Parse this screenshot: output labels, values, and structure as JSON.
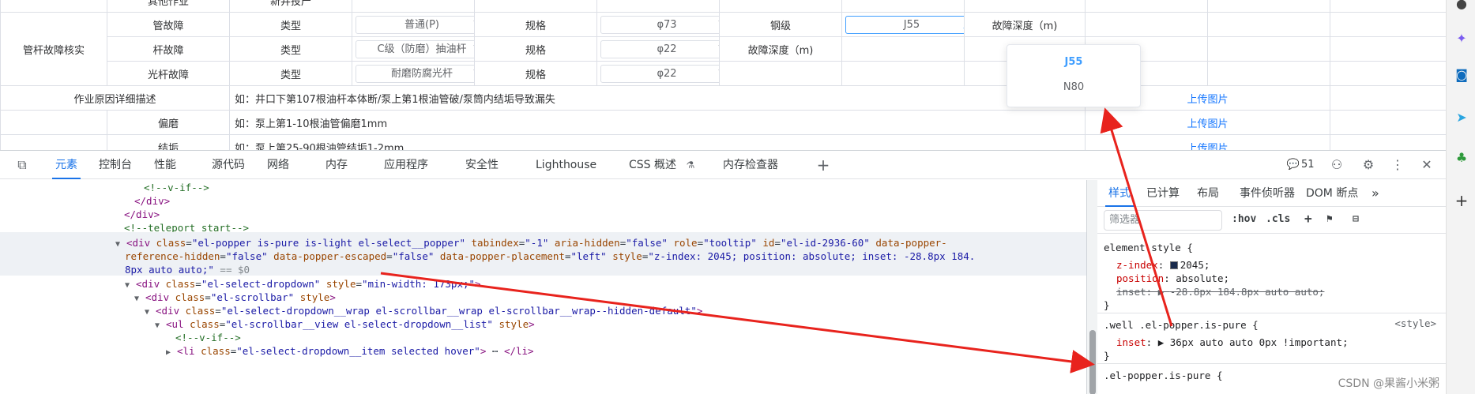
{
  "table": {
    "row0": {
      "c1": "其他作业",
      "c2": "新井投产"
    },
    "group_label": "管杆故障核实",
    "pipe_fault": {
      "label": "管故障",
      "type_label": "类型",
      "type_value": "普通(P)",
      "spec_label": "规格",
      "spec_value": "φ73",
      "grade_label": "钢级",
      "grade_value": "J55",
      "depth_label": "故障深度（m)"
    },
    "rod_fault": {
      "label": "杆故障",
      "type_label": "类型",
      "type_value": "C级（防磨）抽油杆",
      "spec_label": "规格",
      "spec_value": "φ22",
      "depth_label": "故障深度（m)"
    },
    "polished_rod_fault": {
      "label": "光杆故障",
      "type_label": "类型",
      "type_value": "耐磨防腐光杆",
      "spec_label": "规格",
      "spec_value": "φ22"
    },
    "reason_row": {
      "label": "作业原因详细描述",
      "text": "如：井口下第107根油杆本体断/泵上第1根油管破/泵筒内结垢导致漏失",
      "upload": "上传图片"
    },
    "wear_row": {
      "label": "偏磨",
      "text": "如：泵上第1-10根油管偏磨1mm",
      "upload": "上传图片"
    },
    "scale_row": {
      "label": "结垢",
      "text": "如：泵上第25-90根油管结垢1-2mm",
      "upload": "上传图片"
    }
  },
  "dropdown": {
    "options": [
      "J55",
      "N80"
    ],
    "selected": "J55"
  },
  "browser_sidebar": {
    "icons": [
      "account-icon",
      "copilot-icon",
      "outlook-icon",
      "telegram-icon",
      "tree-icon",
      "add-icon"
    ]
  },
  "devtools": {
    "tabs": [
      "元素",
      "控制台",
      "性能",
      "源代码",
      "网络",
      "内存",
      "应用程序",
      "安全性",
      "Lighthouse",
      "CSS 概述",
      "内存检查器"
    ],
    "active_tab": "元素",
    "issues_count": "51",
    "elements_lines": {
      "l1": "<!--v-if-->",
      "l2_tag": "</div>",
      "l3_tag": "</div>",
      "l4": "<!--teleport start-->",
      "l5_open": "<div ",
      "l5_a1": "class",
      "l5_v1": "\"el-popper is-pure is-light el-select__popper\"",
      "l5_a2": "tabindex",
      "l5_v2": "\"-1\"",
      "l5_a3": "aria-hidden",
      "l5_v3": "\"false\"",
      "l5_a4": "role",
      "l5_v4": "\"tooltip\"",
      "l5_a5": "id",
      "l5_v5": "\"el-id-2936-60\"",
      "l5_a6": "data-popper-",
      "l6_a6b": "reference-hidden",
      "l6_v6": "\"false\"",
      "l6_a7": "data-popper-escaped",
      "l6_v7": "\"false\"",
      "l6_a8": "data-popper-placement",
      "l6_v8": "\"left\"",
      "l6_a9": "style",
      "l6_v9": "\"z-index: 2045; position: absolute; inset: -28.8px 184.",
      "l7_v9b": "8px auto auto;\"",
      "l7_eq": "== $0",
      "l8_open": "<div ",
      "l8_a": "class",
      "l8_v": "\"el-select-dropdown\"",
      "l8_a2": "style",
      "l8_v2": "\"min-width: 173px;\"",
      "l9_open": "<div ",
      "l9_a": "class",
      "l9_v": "\"el-scrollbar\"",
      "l9_a2": "style",
      "l10_open": "<div ",
      "l10_a": "class",
      "l10_v": "\"el-select-dropdown__wrap el-scrollbar__wrap el-scrollbar__wrap--hidden-default\"",
      "l11_open": "<ul ",
      "l11_a": "class",
      "l11_v": "\"el-scrollbar__view el-select-dropdown__list\"",
      "l11_a2": "style",
      "l12": "<!--v-if-->",
      "l13_open": "<li ",
      "l13_a": "class",
      "l13_v": "\"el-select-dropdown__item selected hover\"",
      "l13_close": "</li>"
    },
    "styles": {
      "tabs": [
        "样式",
        "已计算",
        "布局",
        "事件侦听器",
        "DOM 断点"
      ],
      "active_tab": "样式",
      "filter_placeholder": "筛选器",
      "hov": ":hov",
      "cls": ".cls",
      "rule1_selector": "element.style {",
      "rule1_p1": "z-index",
      "rule1_v1": "2045;",
      "rule1_p2": "position",
      "rule1_v2": "absolute;",
      "rule1_p3": "inset",
      "rule1_v3": "-28.8px 184.8px auto auto;",
      "rule1_close": "}",
      "rule2_selector": ".well .el-popper.is-pure {",
      "rule2_source": "<style>",
      "rule2_p1": "inset",
      "rule2_v1": "36px auto auto 0px !important;",
      "rule2_close": "}",
      "rule3_partial": ".el-popper.is-pure {"
    }
  },
  "watermark": "CSDN @果酱小米粥",
  "colors": {
    "accent": "#1a73e8",
    "link": "#1677ff",
    "arrow": "#e8231d"
  }
}
